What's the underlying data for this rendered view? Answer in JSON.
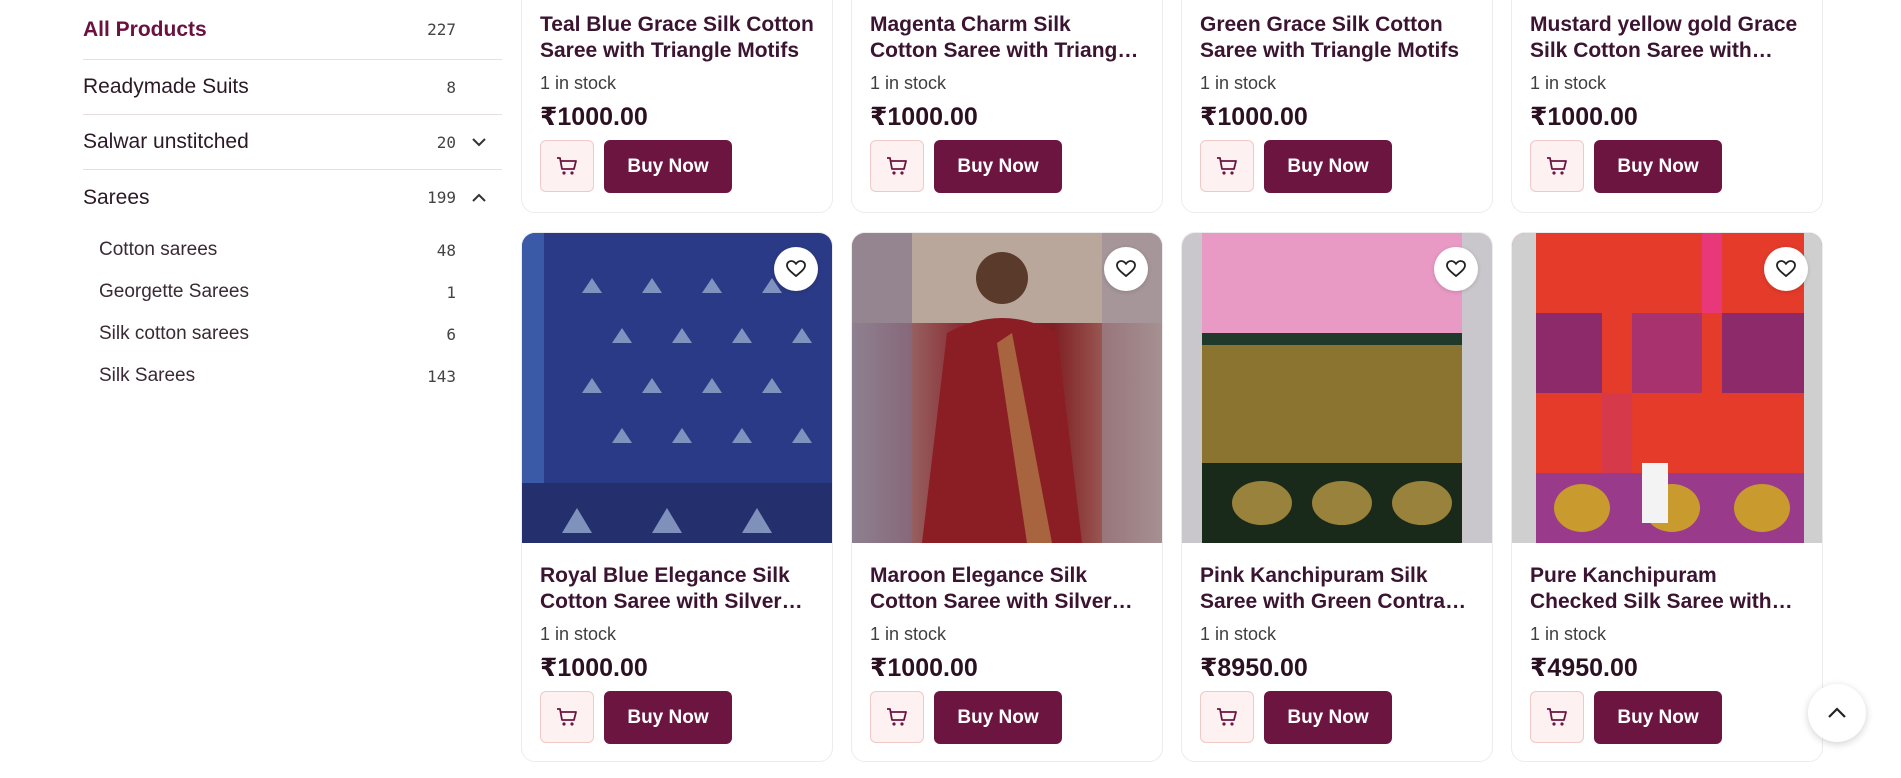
{
  "sidebar": {
    "categories": [
      {
        "label": "All Products",
        "count": "227"
      },
      {
        "label": "Readymade Suits",
        "count": "8"
      },
      {
        "label": "Salwar unstitched",
        "count": "20"
      },
      {
        "label": "Sarees",
        "count": "199"
      }
    ],
    "subcategories": [
      {
        "label": "Cotton sarees",
        "count": "48"
      },
      {
        "label": "Georgette Sarees",
        "count": "1"
      },
      {
        "label": "Silk cotton sarees",
        "count": "6"
      },
      {
        "label": "Silk Sarees",
        "count": "143"
      }
    ]
  },
  "products_top": [
    {
      "title": "Teal Blue Grace Silk Cotton Saree with Triangle Motifs",
      "stock": "1 in stock",
      "price": "₹1000.00"
    },
    {
      "title": "Magenta Charm Silk Cotton Saree with Triangle Motifs",
      "stock": "1 in stock",
      "price": "₹1000.00"
    },
    {
      "title": "Green Grace Silk Cotton Saree with Triangle Motifs",
      "stock": "1 in stock",
      "price": "₹1000.00"
    },
    {
      "title": "Mustard yellow gold Grace Silk Cotton Saree with Triangle Motifs",
      "stock": "1 in stock",
      "price": "₹1000.00"
    }
  ],
  "products_bottom": [
    {
      "title": "Royal Blue Elegance Silk Cotton Saree with Silver Triangle Motifs",
      "stock": "1 in stock",
      "price": "₹1000.00"
    },
    {
      "title": "Maroon Elegance Silk Cotton Saree with Silver Zari",
      "stock": "1 in stock",
      "price": "₹1000.00"
    },
    {
      "title": "Pink Kanchipuram Silk Saree with Green Contrast Border",
      "stock": "1 in stock",
      "price": "₹8950.00"
    },
    {
      "title": "Pure Kanchipuram Checked Silk Saree with Broad Gold Border",
      "stock": "1 in stock",
      "price": "₹4950.00"
    }
  ],
  "buttons": {
    "buy_now": "Buy Now"
  },
  "icons": {
    "cart": "cart-icon",
    "wishlist": "heart-icon",
    "scroll_top": "chevron-up-icon",
    "expand": "chevron-down-icon",
    "collapse": "chevron-up-icon"
  },
  "colors": {
    "brand": "#6d1541",
    "accent_light": "#fdf2f1",
    "active_category": "#6b1140"
  }
}
